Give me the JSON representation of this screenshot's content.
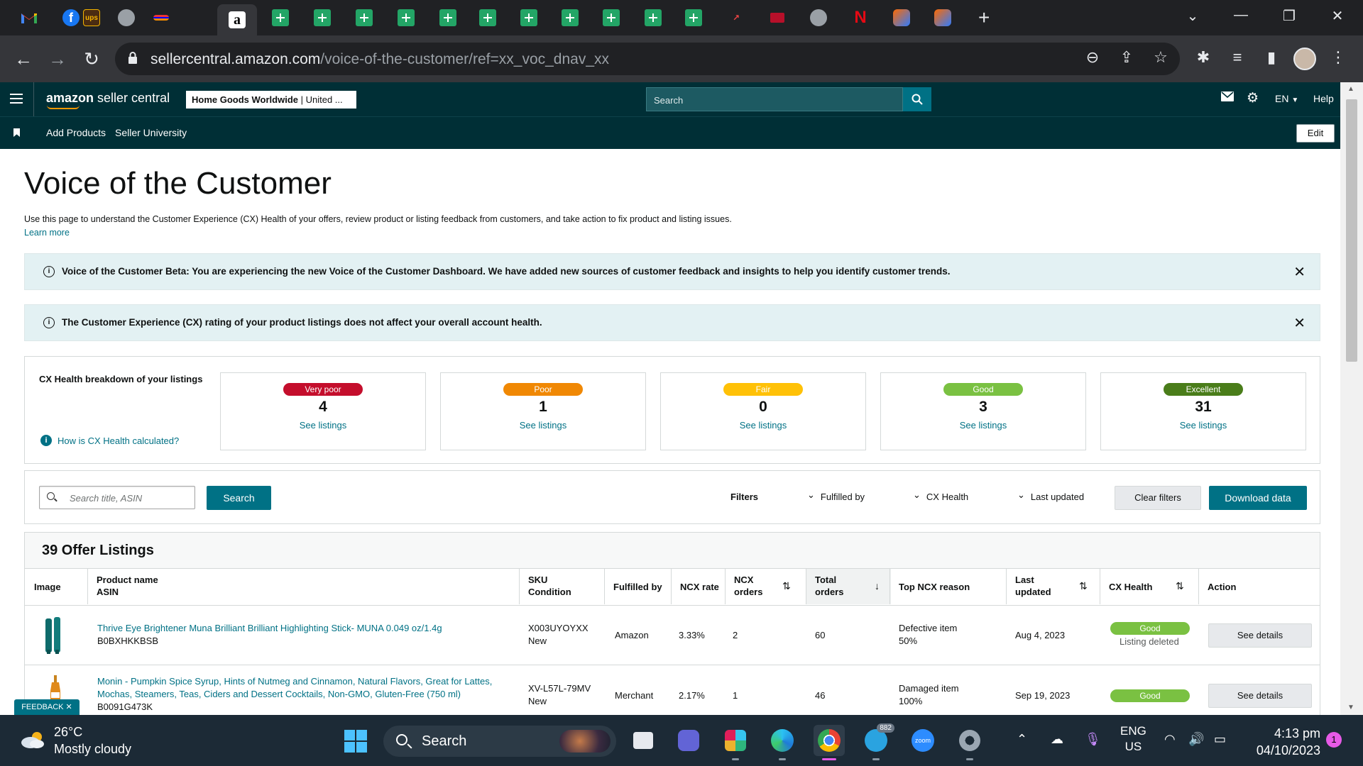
{
  "browser": {
    "tabs": [
      {
        "icon": "gmail-icon"
      },
      {
        "icon": "facebook-icon"
      },
      {
        "icon": "ups-icon"
      },
      {
        "icon": "globe-icon"
      },
      {
        "icon": "mail-icon"
      },
      {
        "icon": "amazon-icon",
        "active": true
      },
      {
        "icon": "sheets-icon"
      },
      {
        "icon": "sheets-icon"
      },
      {
        "icon": "sheets-icon"
      },
      {
        "icon": "sheets-icon"
      },
      {
        "icon": "sheets-icon"
      },
      {
        "icon": "sheets-icon"
      },
      {
        "icon": "sheets-icon"
      },
      {
        "icon": "sheets-icon"
      },
      {
        "icon": "sheets-icon"
      },
      {
        "icon": "sheets-icon"
      },
      {
        "icon": "sheets-icon"
      },
      {
        "icon": "chart-icon"
      },
      {
        "icon": "shield-icon"
      },
      {
        "icon": "globe-icon"
      },
      {
        "icon": "netflix-icon"
      },
      {
        "icon": "tool-icon"
      },
      {
        "icon": "tool-icon"
      }
    ],
    "new_tab_label": "+",
    "url_host": "sellercentral.amazon.com",
    "url_path": "/voice-of-the-customer/ref=xx_voc_dnav_xx",
    "amazon_fav_letter": "a",
    "netflix_letter": "N"
  },
  "amazon_header": {
    "logo_bold": "amazon",
    "logo_rest": " seller central",
    "store_bold": "Home Goods Worldwide",
    "store_rest": " | United ...",
    "search_placeholder": "Search",
    "language": "EN",
    "help": "Help",
    "nav_links": [
      "Add Products",
      "Seller University"
    ],
    "edit_label": "Edit"
  },
  "page": {
    "title": "Voice of the Customer",
    "description": "Use this page to understand the Customer Experience (CX) Health of your offers, review product or listing feedback from customers, and take action to fix product and listing issues.",
    "learn_more": "Learn more",
    "banner_beta": "Voice of the Customer Beta: You are experiencing the new Voice of the Customer Dashboard. We have added new sources of customer feedback and insights to help you identify customer trends.",
    "banner_cx": "The Customer Experience (CX) rating of your product listings does not affect your overall account health.",
    "info_glyph": "i",
    "close_glyph": "✕"
  },
  "cx_health": {
    "title": "CX Health breakdown of your listings",
    "help_link": "How is CX Health calculated?",
    "cards": [
      {
        "label": "Very poor",
        "count": "4",
        "link": "See listings",
        "color": "#c40e2c"
      },
      {
        "label": "Poor",
        "count": "1",
        "link": "See listings",
        "color": "#f08804"
      },
      {
        "label": "Fair",
        "count": "0",
        "link": "See listings",
        "color": "#ffc107"
      },
      {
        "label": "Good",
        "count": "3",
        "link": "See listings",
        "color": "#7ac142"
      },
      {
        "label": "Excellent",
        "count": "31",
        "link": "See listings",
        "color": "#4a7d1a"
      }
    ]
  },
  "filters": {
    "search_placeholder": "Search title, ASIN",
    "search_button": "Search",
    "filters_label": "Filters",
    "fulfilled_by": "Fulfilled by",
    "cx_health": "CX Health",
    "last_updated": "Last updated",
    "clear_filters": "Clear filters",
    "download_data": "Download data"
  },
  "listings": {
    "title": "39 Offer Listings",
    "columns": {
      "image": "Image",
      "product_name": "Product name",
      "asin": "ASIN",
      "sku": "SKU",
      "condition": "Condition",
      "fulfilled_by": "Fulfilled by",
      "ncx_rate": "NCX rate",
      "ncx_orders_1": "NCX",
      "ncx_orders_2": "orders",
      "total_orders_1": "Total",
      "total_orders_2": "orders",
      "top_ncx_reason": "Top NCX reason",
      "last_updated_1": "Last",
      "last_updated_2": "updated",
      "cx_health": "CX Health",
      "action": "Action"
    },
    "rows": [
      {
        "product_name": "Thrive Eye Brightener Muna Brilliant Brilliant Highlighting Stick- MUNA 0.049 oz/1.4g",
        "asin": "B0BXHKKBSB",
        "sku": "X003UYOYXX",
        "condition": "New",
        "fulfilled_by": "Amazon",
        "ncx_rate": "3.33%",
        "ncx_orders": "2",
        "total_orders": "60",
        "reason": "Defective item",
        "reason_pct": "50%",
        "last_updated": "Aug 4, 2023",
        "cx_health": "Good",
        "cx_note": "Listing deleted",
        "action": "See details"
      },
      {
        "product_name_1": "Monin - Pumpkin Spice Syrup, Hints of Nutmeg and Cinnamon, Natural Flavors, Great for Lattes,",
        "product_name_2": "Mochas, Steamers, Teas, Ciders and Dessert Cocktails, Non-GMO, Gluten-Free (750 ml)",
        "asin": "B0091G473K",
        "sku": "XV-L57L-79MV",
        "condition": "New",
        "fulfilled_by": "Merchant",
        "ncx_rate": "2.17%",
        "ncx_orders": "1",
        "total_orders": "46",
        "reason": "Damaged item",
        "reason_pct": "100%",
        "last_updated": "Sep 19, 2023",
        "cx_health": "Good",
        "action": "See details"
      }
    ]
  },
  "feedback_tab": "FEEDBACK ✕",
  "taskbar": {
    "temperature": "26°C",
    "weather": "Mostly cloudy",
    "search_label": "Search",
    "telegram_badge": "882",
    "zoom_label": "zoom",
    "lang_1": "ENG",
    "lang_2": "US",
    "time": "4:13 pm",
    "date": "04/10/2023",
    "notifications": "1"
  }
}
